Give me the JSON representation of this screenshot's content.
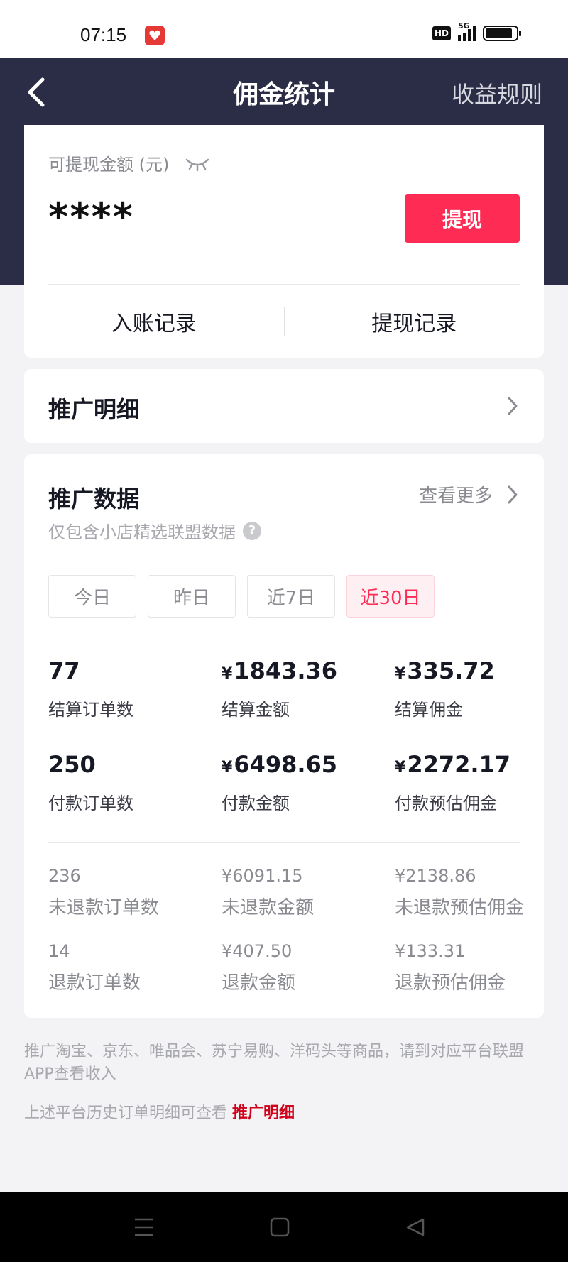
{
  "status_bar": {
    "time": "07:15",
    "hd": "HD",
    "network": "5G"
  },
  "header": {
    "title": "佣金统计",
    "rule_link": "收益规则"
  },
  "balance": {
    "label": "可提现金额 (元)",
    "amount": "****",
    "withdraw_label": "提现",
    "income_records": "入账记录",
    "withdraw_records": "提现记录"
  },
  "promo_detail": {
    "title": "推广明细"
  },
  "promo_data": {
    "title": "推广数据",
    "view_more": "查看更多",
    "subtitle": "仅包含小店精选联盟数据",
    "tabs": [
      {
        "label": "今日",
        "active": false
      },
      {
        "label": "昨日",
        "active": false
      },
      {
        "label": "近7日",
        "active": false
      },
      {
        "label": "近30日",
        "active": true
      }
    ],
    "currency": "¥",
    "stats": [
      [
        {
          "value": "77",
          "label": "结算订单数"
        },
        {
          "value": "1843.36",
          "label": "结算金额"
        },
        {
          "value": "335.72",
          "label": "结算佣金"
        }
      ],
      [
        {
          "value": "250",
          "label": "付款订单数"
        },
        {
          "value": "6498.65",
          "label": "付款金额"
        },
        {
          "value": "2272.17",
          "label": "付款预估佣金"
        }
      ]
    ],
    "sub_stats": [
      [
        {
          "value": "236",
          "label": "未退款订单数"
        },
        {
          "value": "¥6091.15",
          "label": "未退款金额"
        },
        {
          "value": "¥2138.86",
          "label": "未退款预估佣金"
        }
      ],
      [
        {
          "value": "14",
          "label": "退款订单数"
        },
        {
          "value": "¥407.50",
          "label": "退款金额"
        },
        {
          "value": "¥133.31",
          "label": "退款预估佣金"
        }
      ]
    ]
  },
  "footer": {
    "note": "推广淘宝、京东、唯品会、苏宁易购、洋码头等商品，请到对应平台联盟APP查看收入",
    "note2": "上述平台历史订单明细可查看",
    "note2_link": "推广明细"
  },
  "colors": {
    "header_bg": "#2b2c45",
    "accent": "#fe2c55",
    "link": "#d0021b"
  }
}
